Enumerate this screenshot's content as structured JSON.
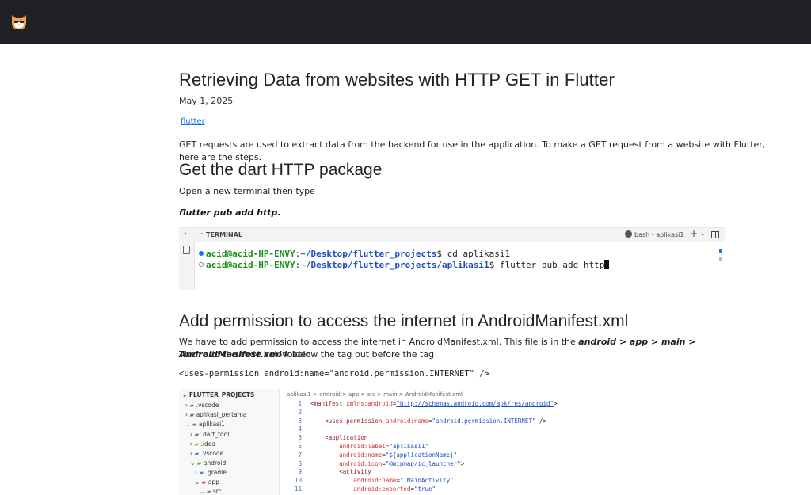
{
  "header": {
    "logo_icon": "cat-face-icon",
    "bg": "#202124"
  },
  "post": {
    "title": "Retrieving Data from websites with HTTP GET in Flutter",
    "date": "May 1, 2025",
    "tag": "flutter",
    "intro": "GET requests are used to extract data from the backend for use in the application. To make a GET request from a website with Flutter, here are the steps."
  },
  "section1": {
    "heading": "Get the dart HTTP package",
    "text": "Open a new terminal then type",
    "command": "flutter pub add http."
  },
  "terminal": {
    "tab": "TERMINAL",
    "shell": "bash - aplikasi1",
    "lines": [
      {
        "user": "acid@acid-HP-ENVY",
        "path": "~/Desktop/flutter_projects",
        "cmd": "$ cd aplikasi1"
      },
      {
        "user": "acid@acid-HP-ENVY",
        "path": "~/Desktop/flutter_projects/aplikasi1",
        "cmd": "$ flutter pub add http"
      }
    ]
  },
  "section2": {
    "heading": "Add permission to access the internet in AndroidManifest.xml",
    "text_a": "We have to add permission to access the internet in AndroidManifest.xml. This file is in the ",
    "path": "android > app > main > AndroidManifest.xml",
    "text_b": " folder.",
    "text_c": "Then add the code below below the tag but before the tag",
    "code": "<uses-permission android:name=\"android.permission.INTERNET\" />"
  },
  "editor": {
    "explorer_title": "FLUTTER_PROJECTS",
    "tree": [
      ".vscode",
      "aplikasi_pertama",
      "aplikasi1",
      ".dart_tool",
      ".idea",
      ".vscode",
      "android",
      ".gradle",
      "app",
      "src"
    ],
    "breadcrumb": "aplikasi1 > android > app > src > main > AndroidManifest.xml",
    "line_numbers": [
      "1",
      "2",
      "3",
      "4",
      "5",
      "6",
      "7",
      "8",
      "9",
      "10",
      "11"
    ],
    "code_lines": [
      "<manifest xmlns:android=\"http://schemas.android.com/apk/res/android\">",
      "",
      "    <uses-permission android:name=\"android.permission.INTERNET\" />",
      "",
      "    <application",
      "        android:label=\"aplikasi1\"",
      "        android:name=\"${applicationName}\"",
      "        android:icon=\"@mipmap/ic_launcher\">",
      "        <activity",
      "            android:name=\".MainActivity\"",
      "            android:exported=\"true\""
    ]
  }
}
